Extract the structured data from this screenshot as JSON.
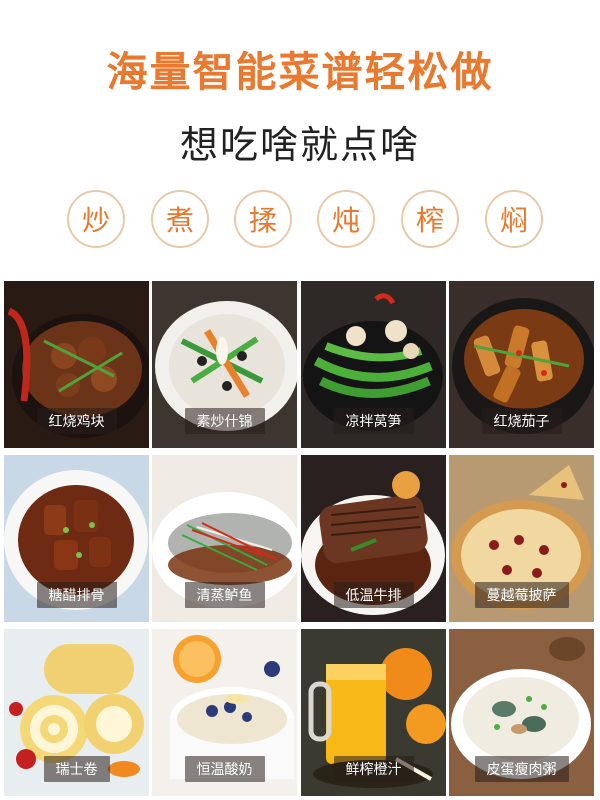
{
  "header": {
    "title": "海量智能菜谱轻松做",
    "subtitle": "想吃啥就点啥"
  },
  "methods": [
    "炒",
    "煮",
    "揉",
    "炖",
    "榨",
    "焖"
  ],
  "recipes": [
    {
      "name": "红烧鸡块",
      "icon": "braised-chicken"
    },
    {
      "name": "素炒什锦",
      "icon": "stir-fried-vegetables"
    },
    {
      "name": "凉拌莴笋",
      "icon": "cold-lettuce-salad"
    },
    {
      "name": "红烧茄子",
      "icon": "braised-eggplant"
    },
    {
      "name": "糖醋排骨",
      "icon": "sweet-sour-ribs"
    },
    {
      "name": "清蒸鲈鱼",
      "icon": "steamed-bass"
    },
    {
      "name": "低温牛排",
      "icon": "sous-vide-steak"
    },
    {
      "name": "蔓越莓披萨",
      "icon": "cranberry-pizza"
    },
    {
      "name": "瑞士卷",
      "icon": "swiss-roll"
    },
    {
      "name": "恒温酸奶",
      "icon": "yogurt"
    },
    {
      "name": "鲜榨橙汁",
      "icon": "orange-juice"
    },
    {
      "name": "皮蛋瘦肉粥",
      "icon": "century-egg-porridge"
    }
  ],
  "colors": {
    "accent": "#e8792e",
    "circle_border": "#e8c9a8",
    "subtitle": "#222222"
  }
}
